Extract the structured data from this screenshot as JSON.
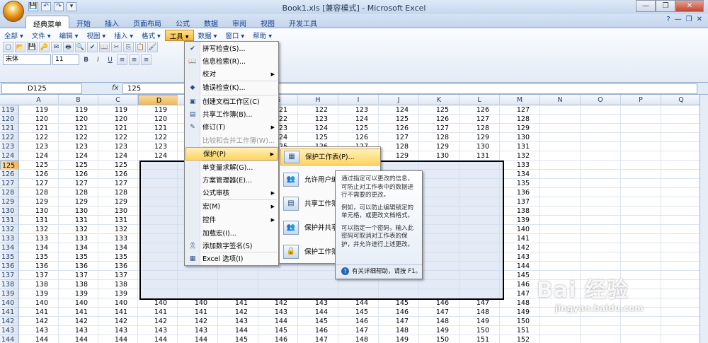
{
  "window": {
    "title": "Book1.xls  [兼容模式] - Microsoft Excel",
    "minimize": "—",
    "restore": "❐",
    "close": "✕"
  },
  "qat": [
    "💾",
    "↶",
    "↷",
    "▾"
  ],
  "tabs": [
    "经典菜单",
    "开始",
    "插入",
    "页面布局",
    "公式",
    "数据",
    "审阅",
    "视图",
    "开发工具"
  ],
  "help_icons": [
    "?",
    "—",
    "❐",
    "✕"
  ],
  "menubar": [
    "全部 ▾",
    "文件 ▾",
    "编辑 ▾",
    "视图 ▾",
    "插入 ▾",
    "格式 ▾",
    "工具 ▾",
    "数据 ▾",
    "窗口 ▾",
    "帮助 ▾"
  ],
  "toolbar": {
    "font": "宋体",
    "size": "11",
    "bold": "B",
    "italic": "I",
    "underline": "U"
  },
  "formula": {
    "namebox": "D125",
    "fx": "fx",
    "value": "125"
  },
  "columns": [
    "A",
    "B",
    "C",
    "D",
    "E",
    "F",
    "G",
    "H",
    "I",
    "J",
    "K",
    "L",
    "M",
    "N",
    "O",
    "P",
    "Q"
  ],
  "rows": [
    {
      "n": "119",
      "v": [
        "119",
        "119",
        "119",
        "119",
        "",
        "",
        "21",
        "122",
        "123",
        "124",
        "125",
        "126",
        "127"
      ]
    },
    {
      "n": "120",
      "v": [
        "120",
        "120",
        "120",
        "120",
        "",
        "",
        "22",
        "123",
        "124",
        "125",
        "126",
        "127",
        "128"
      ]
    },
    {
      "n": "121",
      "v": [
        "121",
        "121",
        "121",
        "121",
        "",
        "",
        "23",
        "124",
        "125",
        "126",
        "127",
        "128",
        "129"
      ]
    },
    {
      "n": "122",
      "v": [
        "122",
        "122",
        "122",
        "122",
        "",
        "",
        "24",
        "125",
        "126",
        "127",
        "128",
        "129",
        "130"
      ]
    },
    {
      "n": "123",
      "v": [
        "123",
        "123",
        "123",
        "123",
        "",
        "",
        "25",
        "126",
        "127",
        "128",
        "129",
        "130",
        "131"
      ]
    },
    {
      "n": "124",
      "v": [
        "124",
        "124",
        "124",
        "124",
        "",
        "",
        "26",
        "",
        "",
        "129",
        "130",
        "131",
        "132"
      ]
    },
    {
      "n": "125",
      "v": [
        "125",
        "125",
        "125",
        "",
        "",
        "",
        "",
        "",
        "",
        "",
        "",
        "",
        "133"
      ]
    },
    {
      "n": "126",
      "v": [
        "126",
        "126",
        "126",
        "",
        "",
        "",
        "",
        "",
        "",
        "",
        "",
        "",
        "134"
      ]
    },
    {
      "n": "127",
      "v": [
        "127",
        "127",
        "127",
        "",
        "",
        "",
        "",
        "",
        "",
        "",
        "",
        "",
        "135"
      ]
    },
    {
      "n": "128",
      "v": [
        "128",
        "128",
        "128",
        "",
        "",
        "",
        "",
        "",
        "",
        "",
        "",
        "",
        "136"
      ]
    },
    {
      "n": "129",
      "v": [
        "129",
        "129",
        "129",
        "",
        "",
        "",
        "",
        "",
        "",
        "",
        "",
        "",
        "137"
      ]
    },
    {
      "n": "130",
      "v": [
        "130",
        "130",
        "130",
        "",
        "",
        "",
        "",
        "",
        "",
        "",
        "",
        "",
        "138"
      ]
    },
    {
      "n": "131",
      "v": [
        "131",
        "131",
        "131",
        "",
        "",
        "",
        "",
        "",
        "",
        "",
        "",
        "",
        "139"
      ]
    },
    {
      "n": "132",
      "v": [
        "132",
        "132",
        "132",
        "",
        "",
        "",
        "",
        "",
        "",
        "",
        "",
        "",
        "140"
      ]
    },
    {
      "n": "133",
      "v": [
        "133",
        "133",
        "133",
        "",
        "",
        "",
        "",
        "",
        "",
        "",
        "",
        "",
        "141"
      ]
    },
    {
      "n": "134",
      "v": [
        "134",
        "134",
        "134",
        "",
        "",
        "",
        "",
        "",
        "",
        "",
        "",
        "",
        "142"
      ]
    },
    {
      "n": "135",
      "v": [
        "135",
        "135",
        "135",
        "",
        "",
        "",
        "",
        "",
        "",
        "",
        "",
        "",
        "143"
      ]
    },
    {
      "n": "136",
      "v": [
        "136",
        "136",
        "136",
        "",
        "",
        "",
        "",
        "",
        "",
        "",
        "",
        "",
        "144"
      ]
    },
    {
      "n": "137",
      "v": [
        "137",
        "137",
        "137",
        "",
        "",
        "",
        "",
        "",
        "",
        "",
        "",
        "",
        "145"
      ]
    },
    {
      "n": "138",
      "v": [
        "138",
        "138",
        "138",
        "",
        "",
        "",
        "",
        "",
        "",
        "",
        "",
        "",
        "146"
      ]
    },
    {
      "n": "139",
      "v": [
        "139",
        "139",
        "139",
        "",
        "",
        "",
        "",
        "",
        "",
        "",
        "",
        "",
        "147"
      ]
    },
    {
      "n": "140",
      "v": [
        "140",
        "140",
        "140",
        "140",
        "140",
        "141",
        "142",
        "143",
        "144",
        "145",
        "146",
        "147",
        "148"
      ]
    },
    {
      "n": "141",
      "v": [
        "141",
        "141",
        "141",
        "141",
        "141",
        "142",
        "143",
        "144",
        "145",
        "146",
        "147",
        "148",
        "149"
      ]
    },
    {
      "n": "142",
      "v": [
        "142",
        "142",
        "142",
        "142",
        "142",
        "143",
        "144",
        "145",
        "146",
        "147",
        "148",
        "149",
        "150"
      ]
    },
    {
      "n": "143",
      "v": [
        "143",
        "143",
        "143",
        "143",
        "143",
        "144",
        "145",
        "146",
        "147",
        "148",
        "149",
        "150",
        "151"
      ]
    },
    {
      "n": "144",
      "v": [
        "144",
        "144",
        "144",
        "144",
        "144",
        "145",
        "146",
        "147",
        "148",
        "149",
        "150",
        "151",
        "152"
      ]
    }
  ],
  "tools_menu": [
    {
      "label": "拼写检查(S)...",
      "icon": "✔"
    },
    {
      "label": "信息检索(R)...",
      "icon": "📖"
    },
    {
      "label": "校对",
      "icon": "",
      "arrow": "▶"
    },
    {
      "label": "错误检查(K)...",
      "icon": "◆"
    },
    {
      "label": "创建文档工作区(C)",
      "icon": "▣"
    },
    {
      "label": "共享工作簿(B)...",
      "icon": "▤"
    },
    {
      "label": "修订(T)",
      "icon": "✎",
      "arrow": "▶"
    },
    {
      "label": "比较和合并工作簿(W)...",
      "icon": ""
    },
    {
      "label": "保护(P)",
      "icon": "",
      "arrow": "▶"
    },
    {
      "label": "单变量求解(G)...",
      "icon": ""
    },
    {
      "label": "方案管理器(E)...",
      "icon": ""
    },
    {
      "label": "公式审核",
      "icon": "",
      "arrow": "▶"
    },
    {
      "label": "宏(M)",
      "icon": "",
      "arrow": "▶"
    },
    {
      "label": "控件",
      "icon": "",
      "arrow": "▶"
    },
    {
      "label": "加载宏(I)...",
      "icon": ""
    },
    {
      "label": "添加数字签名(S)",
      "icon": "🎗"
    },
    {
      "label": "Excel 选项(I)",
      "icon": "▦"
    }
  ],
  "protect_menu": [
    {
      "label": "保护工作表(P)...",
      "icon": "▦"
    },
    {
      "label": "允许用户编",
      "icon": "👥"
    },
    {
      "label": "共享工作簿",
      "icon": "▤"
    },
    {
      "label": "保护并共享",
      "icon": "👥"
    },
    {
      "label": "保护工作簿",
      "icon": "🔒"
    }
  ],
  "tooltip": {
    "p1": "通过指定可以更改的信息，可防止对工作表中的数据进行不需要的更改。",
    "p2": "例如，可以防止编辑锁定的单元格，或更改文档格式。",
    "p3": "可以指定一个密码，输入此密码可取消对工作表的保护，并允许进行上述更改。",
    "help": "有关详细帮助，请按 F1。",
    "help_icon": "?"
  },
  "watermark": {
    "brand": "Bai 经验",
    "url": "jingyan.baidu.com"
  }
}
